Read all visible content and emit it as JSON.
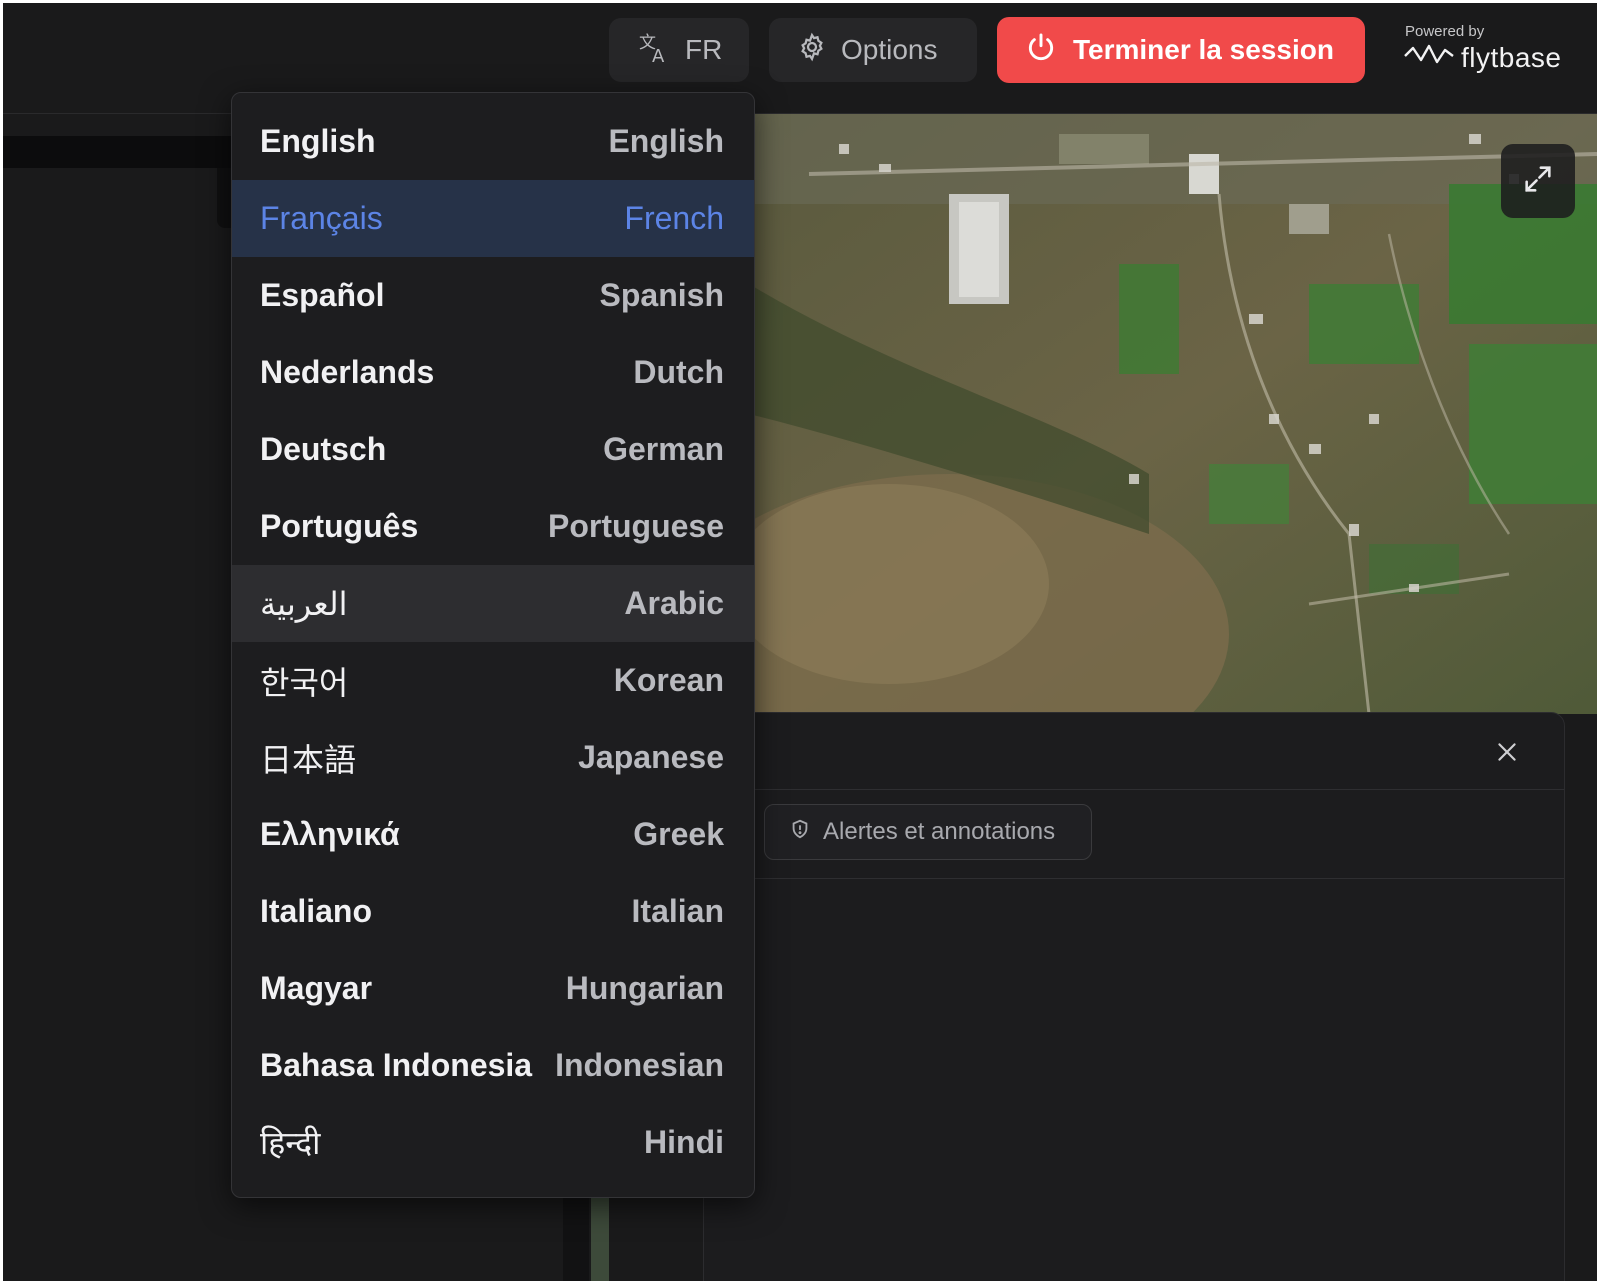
{
  "header": {
    "language_button": {
      "icon": "translate-icon",
      "label": "FR"
    },
    "options_button": {
      "icon": "gear-icon",
      "label": "Options"
    },
    "end_session_button": {
      "icon": "power-icon",
      "label": "Terminer la session",
      "color": "#f14a4a"
    },
    "branding": {
      "powered_by": "Powered by",
      "logo_text": "flytbase"
    }
  },
  "map": {
    "expand_icon": "expand-icon"
  },
  "panel": {
    "close_icon": "close-icon",
    "chip": {
      "icon": "shield-icon",
      "label": "Alertes et annotations"
    }
  },
  "language_menu": {
    "selected": "Français",
    "hovered": "العربية",
    "accent_color": "#5c84e6",
    "items": [
      {
        "native": "English",
        "english": "English"
      },
      {
        "native": "Français",
        "english": "French"
      },
      {
        "native": "Español",
        "english": "Spanish"
      },
      {
        "native": "Nederlands",
        "english": "Dutch"
      },
      {
        "native": "Deutsch",
        "english": "German"
      },
      {
        "native": "Português",
        "english": "Portuguese"
      },
      {
        "native": "العربية",
        "english": "Arabic"
      },
      {
        "native": "한국어",
        "english": "Korean"
      },
      {
        "native": "日本語",
        "english": "Japanese"
      },
      {
        "native": "Ελληνικά",
        "english": "Greek"
      },
      {
        "native": "Italiano",
        "english": "Italian"
      },
      {
        "native": "Magyar",
        "english": "Hungarian"
      },
      {
        "native": "Bahasa Indonesia",
        "english": "Indonesian"
      },
      {
        "native": "हिन्दी",
        "english": "Hindi"
      }
    ]
  }
}
